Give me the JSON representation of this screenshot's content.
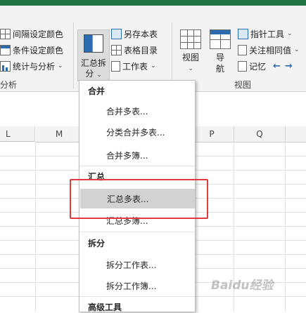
{
  "ribbon": {
    "left_col": [
      {
        "icon": "interval-color-icon",
        "label": "间隔设定颜色"
      },
      {
        "icon": "condition-color-icon",
        "label": "条件设定颜色"
      },
      {
        "icon": "stats-icon",
        "label": "统计与分析",
        "caret": "⌄"
      }
    ],
    "left_group_label": "分析",
    "merge_button": {
      "line1": "汇总拆",
      "line2": "分",
      "caret": "⌄"
    },
    "mid_col": [
      {
        "icon": "save-copy-icon",
        "label": "另存本表"
      },
      {
        "icon": "table-directory-icon",
        "label": "表格目录"
      },
      {
        "icon": "worksheet-icon",
        "label": "工作表",
        "caret": "⌄"
      }
    ],
    "view_button": {
      "line1": "视图",
      "caret": "⌄"
    },
    "nav_button": {
      "line1": "导",
      "line2": "航"
    },
    "right_col": [
      {
        "icon": "pointer-tool-icon",
        "label": "指针工具",
        "caret": "⌄"
      },
      {
        "icon": "focus-same-value-icon",
        "label": "关注相同值",
        "caret": "⌄"
      },
      {
        "icon": "memo-icon",
        "label": "记忆"
      }
    ],
    "view_group_label": "视图",
    "back_arrow": "←",
    "forward_arrow": "→"
  },
  "columns": [
    "L",
    "M",
    "P",
    "Q"
  ],
  "menu": {
    "sections": [
      {
        "header": "合并",
        "items": [
          "合并多表...",
          "分类合并多表...",
          "合并多簿..."
        ]
      },
      {
        "header": "汇总",
        "items": [
          "汇总多表...",
          "汇总多簿..."
        ]
      },
      {
        "header": "拆分",
        "items": [
          "拆分工作表...",
          "拆分工作簿..."
        ]
      },
      {
        "header": "高级工具",
        "items": []
      }
    ]
  },
  "watermark": "Baidu经验",
  "colors": {
    "accent_green": "#217346",
    "highlight_box": "#e33b3b"
  }
}
